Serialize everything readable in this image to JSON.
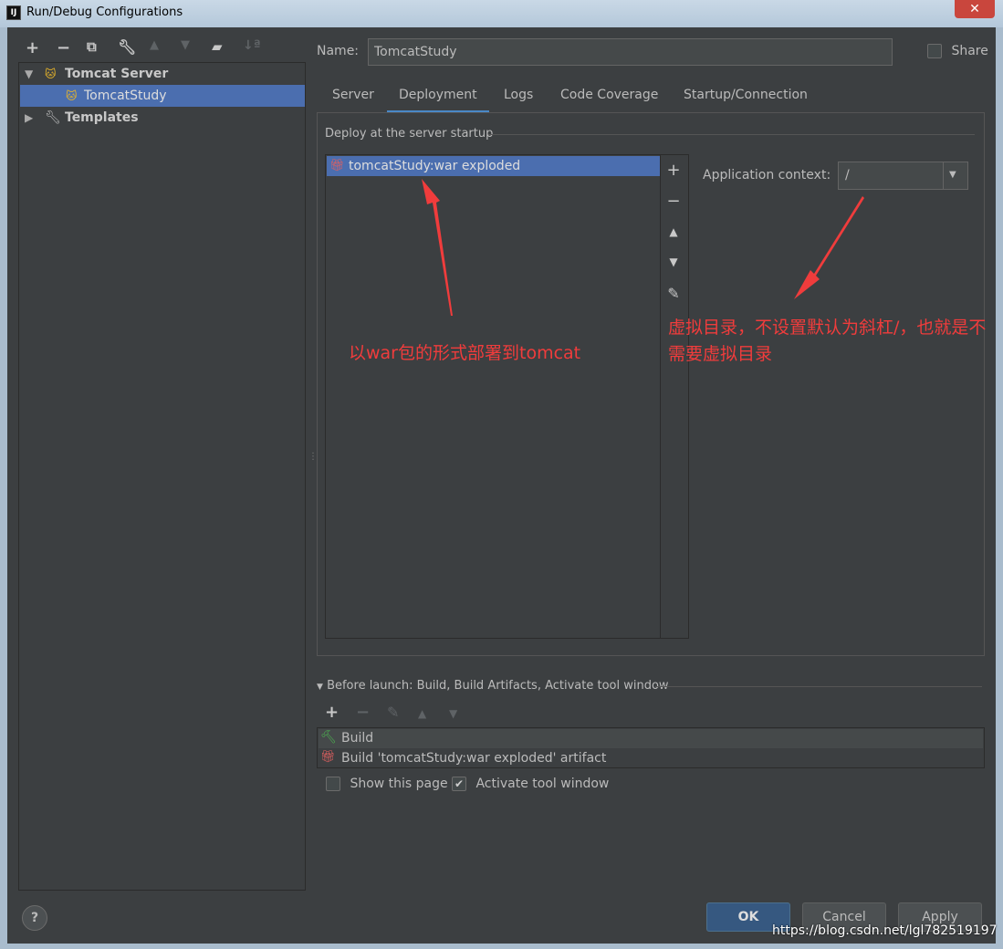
{
  "window": {
    "title": "Run/Debug Configurations",
    "app_icon": "IJ"
  },
  "toolbar": {
    "add": "+",
    "remove": "−"
  },
  "tree": {
    "items": [
      {
        "label": "Tomcat Server"
      },
      {
        "label": "TomcatStudy"
      },
      {
        "label": "Templates"
      }
    ]
  },
  "name": {
    "label": "Name:",
    "value": "TomcatStudy"
  },
  "share": {
    "label": "Share",
    "checked": false
  },
  "tabs": [
    {
      "label": "Server"
    },
    {
      "label": "Deployment",
      "active": true
    },
    {
      "label": "Logs"
    },
    {
      "label": "Code Coverage"
    },
    {
      "label": "Startup/Connection"
    }
  ],
  "deployment": {
    "section_title": "Deploy at the server startup",
    "items": [
      "tomcatStudy:war exploded"
    ],
    "app_context_label": "Application context:",
    "app_context_value": "/"
  },
  "annotations": {
    "left": "以war包的形式部署到tomcat",
    "right": "虚拟目录，不设置默认为斜杠/，也就是不需要虚拟目录"
  },
  "before_launch": {
    "title": "Before launch: Build, Build Artifacts, Activate tool window",
    "items": [
      "Build",
      "Build 'tomcatStudy:war exploded' artifact"
    ],
    "show_page_label": "Show this page",
    "show_page_checked": false,
    "activate_label": "Activate tool window",
    "activate_checked": true
  },
  "buttons": {
    "help": "?",
    "ok": "OK",
    "cancel": "Cancel",
    "apply": "Apply"
  },
  "watermark": "https://blog.csdn.net/lgl782519197",
  "colors": {
    "background": "#3c3f41",
    "selection": "#4b6eaf",
    "annotation": "#f03c3c"
  }
}
